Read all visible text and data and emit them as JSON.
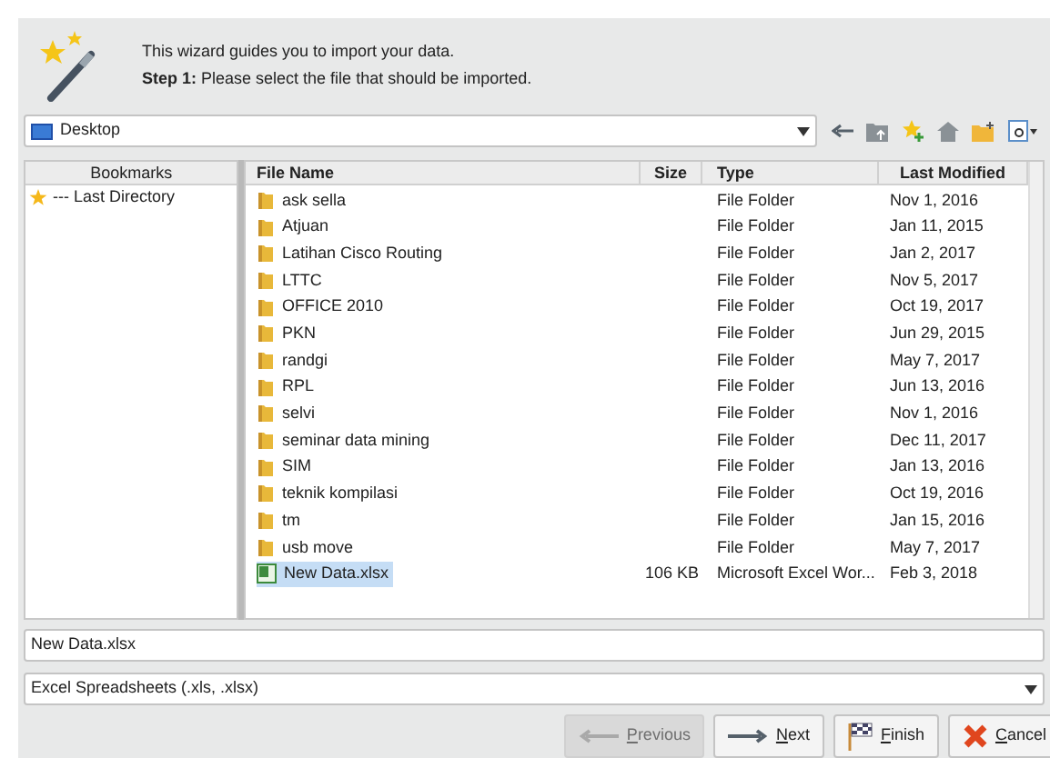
{
  "header": {
    "intro": "This wizard guides you to import your data.",
    "step": "**Step 1:** Please select the file that should be imported."
  },
  "location": {
    "value": "Desktop"
  },
  "bookmarks": {
    "heading": "Bookmarks",
    "items": [
      {
        "label": "--- Last Directory",
        "selected": false
      }
    ]
  },
  "table": {
    "columns": [
      "File Name",
      "Size",
      "Type",
      "Last Modified"
    ],
    "rows": [
      {
        "kind": "folder",
        "name": "ask sella",
        "size": "",
        "type": "File Folder",
        "modified": "Nov 1, 2016",
        "selected": false
      },
      {
        "kind": "folder",
        "name": "Atjuan",
        "size": "",
        "type": "File Folder",
        "modified": "Jan 11, 2015",
        "selected": false
      },
      {
        "kind": "folder",
        "name": "Latihan Cisco Routing",
        "size": "",
        "type": "File Folder",
        "modified": "Jan 2, 2017",
        "selected": false
      },
      {
        "kind": "folder",
        "name": "LTTC",
        "size": "",
        "type": "File Folder",
        "modified": "Nov 5, 2017",
        "selected": false
      },
      {
        "kind": "folder",
        "name": "OFFICE 2010",
        "size": "",
        "type": "File Folder",
        "modified": "Oct 19, 2017",
        "selected": false
      },
      {
        "kind": "folder",
        "name": "PKN",
        "size": "",
        "type": "File Folder",
        "modified": "Jun 29, 2015",
        "selected": false
      },
      {
        "kind": "folder",
        "name": "randgi",
        "size": "",
        "type": "File Folder",
        "modified": "May 7, 2017",
        "selected": false
      },
      {
        "kind": "folder",
        "name": "RPL",
        "size": "",
        "type": "File Folder",
        "modified": "Jun 13, 2016",
        "selected": false
      },
      {
        "kind": "folder",
        "name": "selvi",
        "size": "",
        "type": "File Folder",
        "modified": "Nov 1, 2016",
        "selected": false
      },
      {
        "kind": "folder",
        "name": "seminar data mining",
        "size": "",
        "type": "File Folder",
        "modified": "Dec 11, 2017",
        "selected": false
      },
      {
        "kind": "folder",
        "name": "SIM",
        "size": "",
        "type": "File Folder",
        "modified": "Jan 13, 2016",
        "selected": false
      },
      {
        "kind": "folder",
        "name": "teknik kompilasi",
        "size": "",
        "type": "File Folder",
        "modified": "Oct 19, 2016",
        "selected": false
      },
      {
        "kind": "folder",
        "name": "tm",
        "size": "",
        "type": "File Folder",
        "modified": "Jan 15, 2016",
        "selected": false
      },
      {
        "kind": "folder",
        "name": "usb move",
        "size": "",
        "type": "File Folder",
        "modified": "May 7, 2017",
        "selected": false
      },
      {
        "kind": "excel",
        "name": "New Data.xlsx",
        "size": "106 KB",
        "type": "Microsoft Excel Wor...",
        "modified": "Feb 3, 2018",
        "selected": true
      }
    ]
  },
  "file_name": {
    "value": "New Data.xlsx"
  },
  "file_type": {
    "value": "Excel Spreadsheets (.xls, .xlsx)"
  },
  "buttons": [
    {
      "kind": "previous",
      "label": "Previous",
      "disabled": true
    },
    {
      "kind": "next",
      "label": "Next",
      "disabled": false
    },
    {
      "kind": "finish",
      "label": "Finish",
      "disabled": false
    },
    {
      "kind": "cancel",
      "label": "Cancel",
      "disabled": false
    }
  ]
}
